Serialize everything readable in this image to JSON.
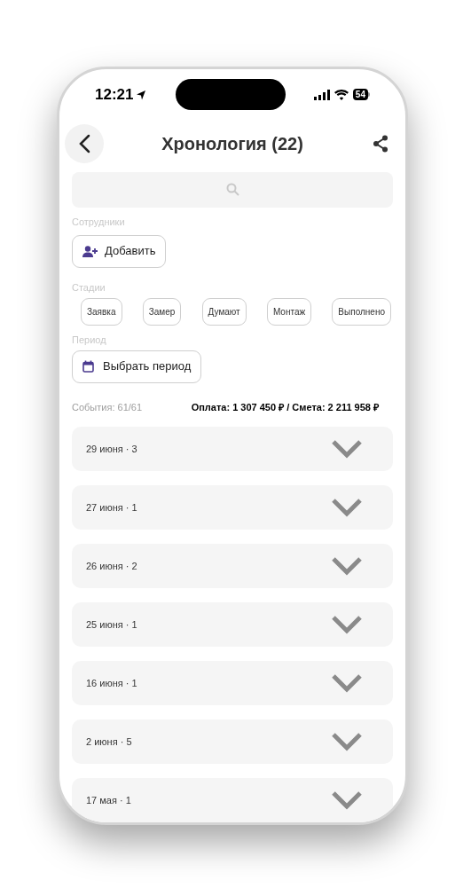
{
  "status_bar": {
    "time": "12:21",
    "battery": "54"
  },
  "header": {
    "title": "Хронология (22)"
  },
  "employees": {
    "label": "Сотрудники",
    "button": "Добавить"
  },
  "stages": {
    "label": "Стадии",
    "chips": [
      {
        "label": "Заявка",
        "selected": false
      },
      {
        "label": "Замер",
        "selected": false
      },
      {
        "label": "Думают",
        "selected": false
      },
      {
        "label": "Монтаж",
        "selected": false
      },
      {
        "label": "Выполнено",
        "selected": false
      }
    ]
  },
  "period": {
    "label": "Период",
    "button": "Выбрать период"
  },
  "summary": {
    "events": "События: 61/61",
    "totals": "Оплата: 1 307 450 ₽ / Смета: 2 211 958 ₽"
  },
  "days": [
    {
      "label": "29 июня · 3",
      "expanded": false
    },
    {
      "label": "27 июня · 1",
      "expanded": false
    },
    {
      "label": "26 июня · 2",
      "expanded": false
    },
    {
      "label": "25 июня · 1",
      "expanded": false
    },
    {
      "label": "16 июня · 1",
      "expanded": false
    },
    {
      "label": "2 июня · 5",
      "expanded": false
    },
    {
      "label": "17 мая · 1",
      "expanded": false
    }
  ]
}
